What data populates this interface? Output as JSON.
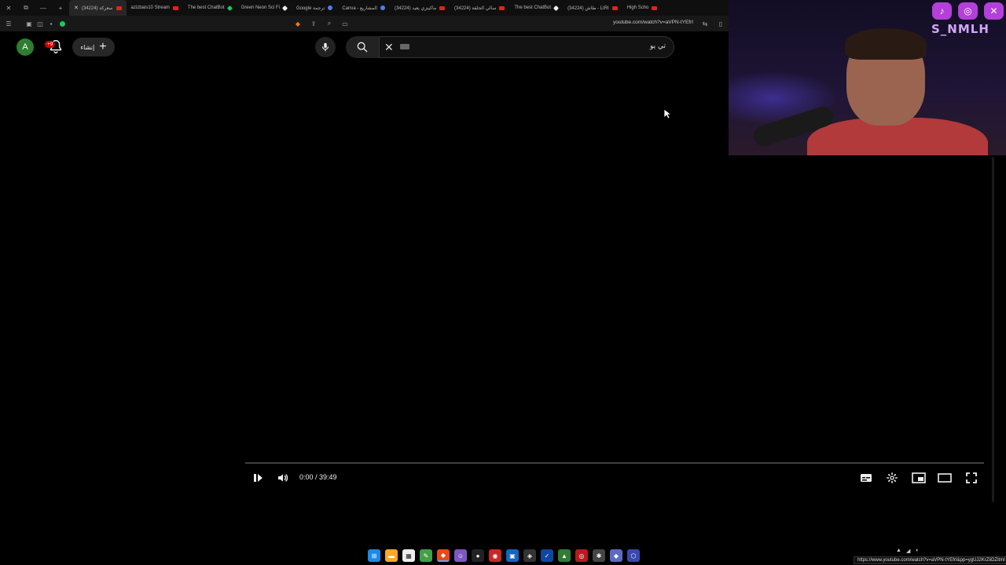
{
  "tabs": [
    {
      "label": "(34224) سعركة",
      "favicon": "youtube",
      "active": true
    },
    {
      "label": "azizbais10 Stream",
      "favicon": "youtube",
      "active": false
    },
    {
      "label": "The best ChatBot",
      "favicon": "green",
      "active": false
    },
    {
      "label": "Green Neon Sci Fi",
      "favicon": "white",
      "active": false
    },
    {
      "label": "Google ترجمة",
      "favicon": "blue",
      "active": false
    },
    {
      "label": "Canva - المشاريع",
      "favicon": "blue",
      "active": false
    },
    {
      "label": "(34224) ماكينزي يعيد",
      "favicon": "youtube",
      "active": false
    },
    {
      "label": "(34224) سالي الحلقة",
      "favicon": "youtube",
      "active": false
    },
    {
      "label": "The best ChatBot",
      "favicon": "white",
      "active": false
    },
    {
      "label": "(34224) طاش - LIRI",
      "favicon": "youtube",
      "active": false
    },
    {
      "label": "High Scho",
      "favicon": "youtube",
      "active": false
    }
  ],
  "toolbar": {
    "url": "youtube.com/watch?v=aVPN-tYEfrI"
  },
  "header": {
    "avatar_letter": "A",
    "notification_count": "+9",
    "create_label": "إنشاء",
    "search_value": "تي يو"
  },
  "player": {
    "time": "0:00 / 39:49",
    "progress": 0.0
  },
  "webcam": {
    "handle": "S_NMLH"
  },
  "status_bar": {
    "url": "https://www.youtube.com/watch?v=aVPN-tYEfrI&pp=ygUJ2KrZiiDZitmI"
  },
  "colors": {
    "accent": "#ff0000",
    "avatar_bg": "#2e7d32",
    "badge": "#cc0000",
    "social": "#b43fd9"
  }
}
